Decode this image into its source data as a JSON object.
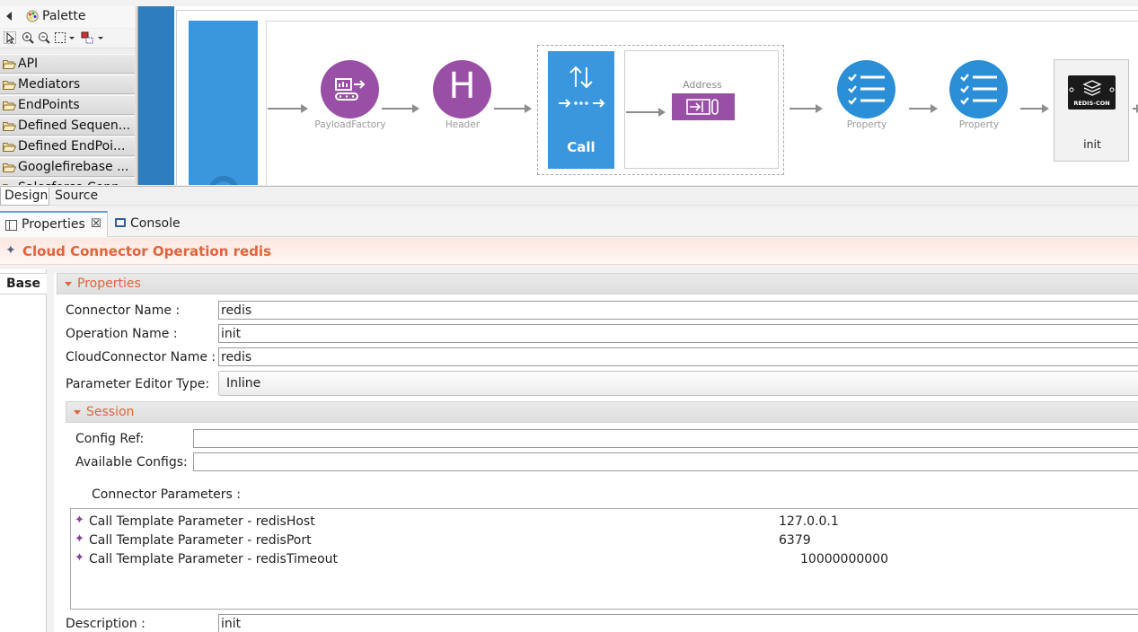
{
  "palette": {
    "title": "Palette",
    "drawers": [
      "API",
      "Mediators",
      "EndPoints",
      "Defined Sequen...",
      "Defined EndPoi...",
      "Googlefirebase ...",
      "Salesforce Conn..."
    ]
  },
  "canvas": {
    "nodes": {
      "payload_factory": "PayloadFactory",
      "header": "Header",
      "header_letter": "H",
      "call": "Call",
      "address": "Address",
      "property1": "Property",
      "property2": "Property",
      "redis_logo_text": "REDIS-CON",
      "redis_op": "init"
    }
  },
  "editor_tabs": [
    "Design",
    "Source"
  ],
  "view_tabs": {
    "properties": "Properties",
    "console": "Console",
    "close": "☒"
  },
  "title": "Cloud Connector Operation redis",
  "side_tab": "Base",
  "sections": {
    "properties": "Properties",
    "session": "Session"
  },
  "fields": {
    "connector_name": {
      "label": "Connector Name :",
      "value": "redis"
    },
    "operation_name": {
      "label": "Operation Name :",
      "value": "init"
    },
    "cloud_connector_name": {
      "label": "CloudConnector Name :",
      "value": "redis"
    },
    "parameter_editor_type": {
      "label": "Parameter Editor Type:",
      "value": "Inline"
    },
    "config_ref": {
      "label": "Config Ref:",
      "value": ""
    },
    "available_configs": {
      "label": "Available Configs:",
      "value": ""
    },
    "connector_parameters": {
      "label": "Connector Parameters :"
    },
    "description": {
      "label": "Description :",
      "value": "init"
    }
  },
  "parameters": [
    {
      "name": "Call Template Parameter  -  redisHost",
      "value": "127.0.0.1"
    },
    {
      "name": "Call Template Parameter  -  redisPort",
      "value": "6379"
    },
    {
      "name": "Call Template Parameter  -  redisTimeout",
      "value": "10000000000"
    }
  ],
  "colors": {
    "accent_orange": "#e0643c",
    "mediator_purple": "#9a4fa6",
    "flow_blue": "#3a96dd",
    "property_blue": "#2b8fd8"
  }
}
